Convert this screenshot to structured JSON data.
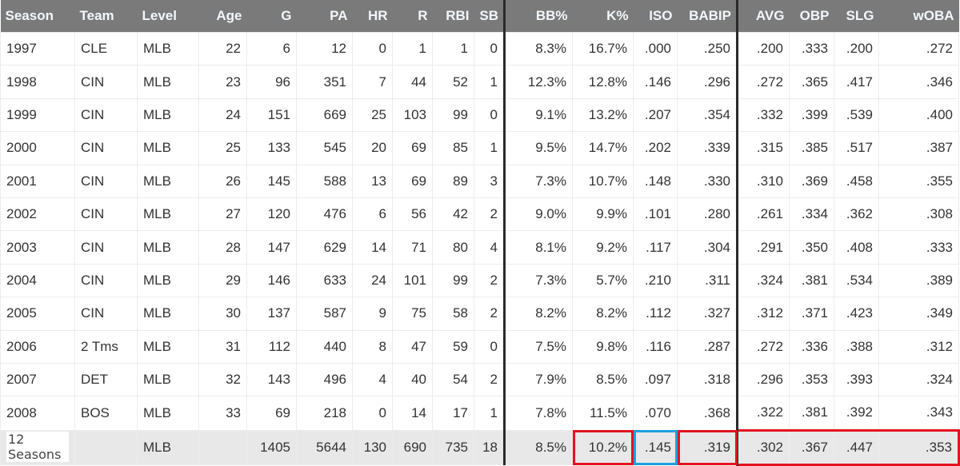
{
  "columns": [
    "Season",
    "Team",
    "Level",
    "Age",
    "G",
    "PA",
    "HR",
    "R",
    "RBI",
    "SB",
    "BB%",
    "K%",
    "ISO",
    "BABIP",
    "AVG",
    "OBP",
    "SLG",
    "wOBA"
  ],
  "rows": [
    [
      "1997",
      "CLE",
      "MLB",
      "22",
      "6",
      "12",
      "0",
      "1",
      "1",
      "0",
      "8.3%",
      "16.7%",
      ".000",
      ".250",
      ".200",
      ".333",
      ".200",
      ".272"
    ],
    [
      "1998",
      "CIN",
      "MLB",
      "23",
      "96",
      "351",
      "7",
      "44",
      "52",
      "1",
      "12.3%",
      "12.8%",
      ".146",
      ".296",
      ".272",
      ".365",
      ".417",
      ".346"
    ],
    [
      "1999",
      "CIN",
      "MLB",
      "24",
      "151",
      "669",
      "25",
      "103",
      "99",
      "0",
      "9.1%",
      "13.2%",
      ".207",
      ".354",
      ".332",
      ".399",
      ".539",
      ".400"
    ],
    [
      "2000",
      "CIN",
      "MLB",
      "25",
      "133",
      "545",
      "20",
      "69",
      "85",
      "1",
      "9.5%",
      "14.7%",
      ".202",
      ".339",
      ".315",
      ".385",
      ".517",
      ".387"
    ],
    [
      "2001",
      "CIN",
      "MLB",
      "26",
      "145",
      "588",
      "13",
      "69",
      "89",
      "3",
      "7.3%",
      "10.7%",
      ".148",
      ".330",
      ".310",
      ".369",
      ".458",
      ".355"
    ],
    [
      "2002",
      "CIN",
      "MLB",
      "27",
      "120",
      "476",
      "6",
      "56",
      "42",
      "2",
      "9.0%",
      "9.9%",
      ".101",
      ".280",
      ".261",
      ".334",
      ".362",
      ".308"
    ],
    [
      "2003",
      "CIN",
      "MLB",
      "28",
      "147",
      "629",
      "14",
      "71",
      "80",
      "4",
      "8.1%",
      "9.2%",
      ".117",
      ".304",
      ".291",
      ".350",
      ".408",
      ".333"
    ],
    [
      "2004",
      "CIN",
      "MLB",
      "29",
      "146",
      "633",
      "24",
      "101",
      "99",
      "2",
      "7.3%",
      "5.7%",
      ".210",
      ".311",
      ".324",
      ".381",
      ".534",
      ".389"
    ],
    [
      "2005",
      "CIN",
      "MLB",
      "30",
      "137",
      "587",
      "9",
      "75",
      "58",
      "2",
      "8.2%",
      "8.2%",
      ".112",
      ".327",
      ".312",
      ".371",
      ".423",
      ".349"
    ],
    [
      "2006",
      "2 Tms",
      "MLB",
      "31",
      "112",
      "440",
      "8",
      "47",
      "59",
      "0",
      "7.5%",
      "9.8%",
      ".116",
      ".287",
      ".272",
      ".336",
      ".388",
      ".312"
    ],
    [
      "2007",
      "DET",
      "MLB",
      "32",
      "143",
      "496",
      "4",
      "40",
      "54",
      "2",
      "7.9%",
      "8.5%",
      ".097",
      ".318",
      ".296",
      ".353",
      ".393",
      ".324"
    ],
    [
      "2008",
      "BOS",
      "MLB",
      "33",
      "69",
      "218",
      "0",
      "14",
      "17",
      "1",
      "7.8%",
      "11.5%",
      ".070",
      ".368",
      ".322",
      ".381",
      ".392",
      ".343"
    ]
  ],
  "total": [
    "12 Seasons",
    "",
    "MLB",
    "",
    "1405",
    "5644",
    "130",
    "690",
    "735",
    "18",
    "8.5%",
    "10.2%",
    ".145",
    ".319",
    ".302",
    ".367",
    ".447",
    ".353"
  ],
  "colors": {
    "header_bg": "#7a7a7a",
    "highlight_red": "#e5121f",
    "highlight_blue": "#1ba1e2",
    "total_bg": "#e8e8e8"
  }
}
